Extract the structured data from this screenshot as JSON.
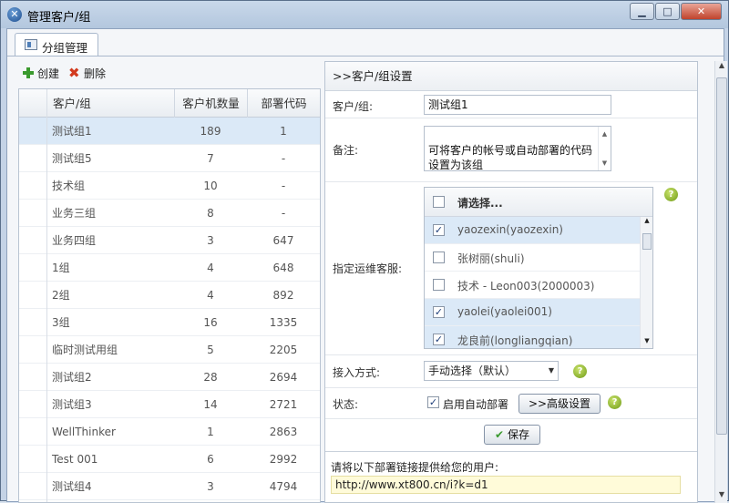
{
  "window": {
    "title": "管理客户/组"
  },
  "tab": {
    "label": "分组管理"
  },
  "toolbar": {
    "create_label": "创建",
    "delete_label": "删除"
  },
  "group_table": {
    "columns": [
      "客户/组",
      "客户机数量",
      "部署代码"
    ],
    "rows": [
      {
        "name": "测试组1",
        "count": "189",
        "code": "1",
        "selected": true
      },
      {
        "name": "测试组5",
        "count": "7",
        "code": "-"
      },
      {
        "name": "技术组",
        "count": "10",
        "code": "-"
      },
      {
        "name": "业务三组",
        "count": "8",
        "code": "-"
      },
      {
        "name": "业务四组",
        "count": "3",
        "code": "647"
      },
      {
        "name": "1组",
        "count": "4",
        "code": "648"
      },
      {
        "name": "2组",
        "count": "4",
        "code": "892"
      },
      {
        "name": "3组",
        "count": "16",
        "code": "1335"
      },
      {
        "name": "临时测试用组",
        "count": "5",
        "code": "2205"
      },
      {
        "name": "测试组2",
        "count": "28",
        "code": "2694"
      },
      {
        "name": "测试组3",
        "count": "14",
        "code": "2721"
      },
      {
        "name": "WellThinker",
        "count": "1",
        "code": "2863"
      },
      {
        "name": "Test 001",
        "count": "6",
        "code": "2992"
      },
      {
        "name": "测试组4",
        "count": "3",
        "code": "4794"
      }
    ]
  },
  "settings": {
    "title": ">>客户/组设置",
    "group_label": "客户/组:",
    "group_value": "测试组1",
    "note_label": "备注:",
    "note_value": "可将客户的帐号或自动部署的代码\n设置为该组",
    "ops_label": "指定运维客服:",
    "ops_header": "请选择...",
    "ops_options": [
      {
        "label": "yaozexin(yaozexin)",
        "checked": true
      },
      {
        "label": "张树丽(shuli)",
        "checked": false
      },
      {
        "label": "技术 - Leon003(2000003)",
        "checked": false
      },
      {
        "label": "yaolei(yaolei001)",
        "checked": true
      },
      {
        "label": "龙良前(longliangqian)",
        "checked": true
      }
    ],
    "access_label": "接入方式:",
    "access_value": "手动选择（默认）",
    "status_label": "状态:",
    "auto_deploy_label": "启用自动部署",
    "advanced_label": ">>高级设置",
    "save_label": "保存",
    "link_prompt": "请将以下部署链接提供给您的用户:",
    "link_value": "http://www.xt800.cn/i?k=d1"
  },
  "colors": {
    "selection": "#dbe9f7",
    "accent": "#3a9a2e",
    "delete": "#d23a1e"
  }
}
